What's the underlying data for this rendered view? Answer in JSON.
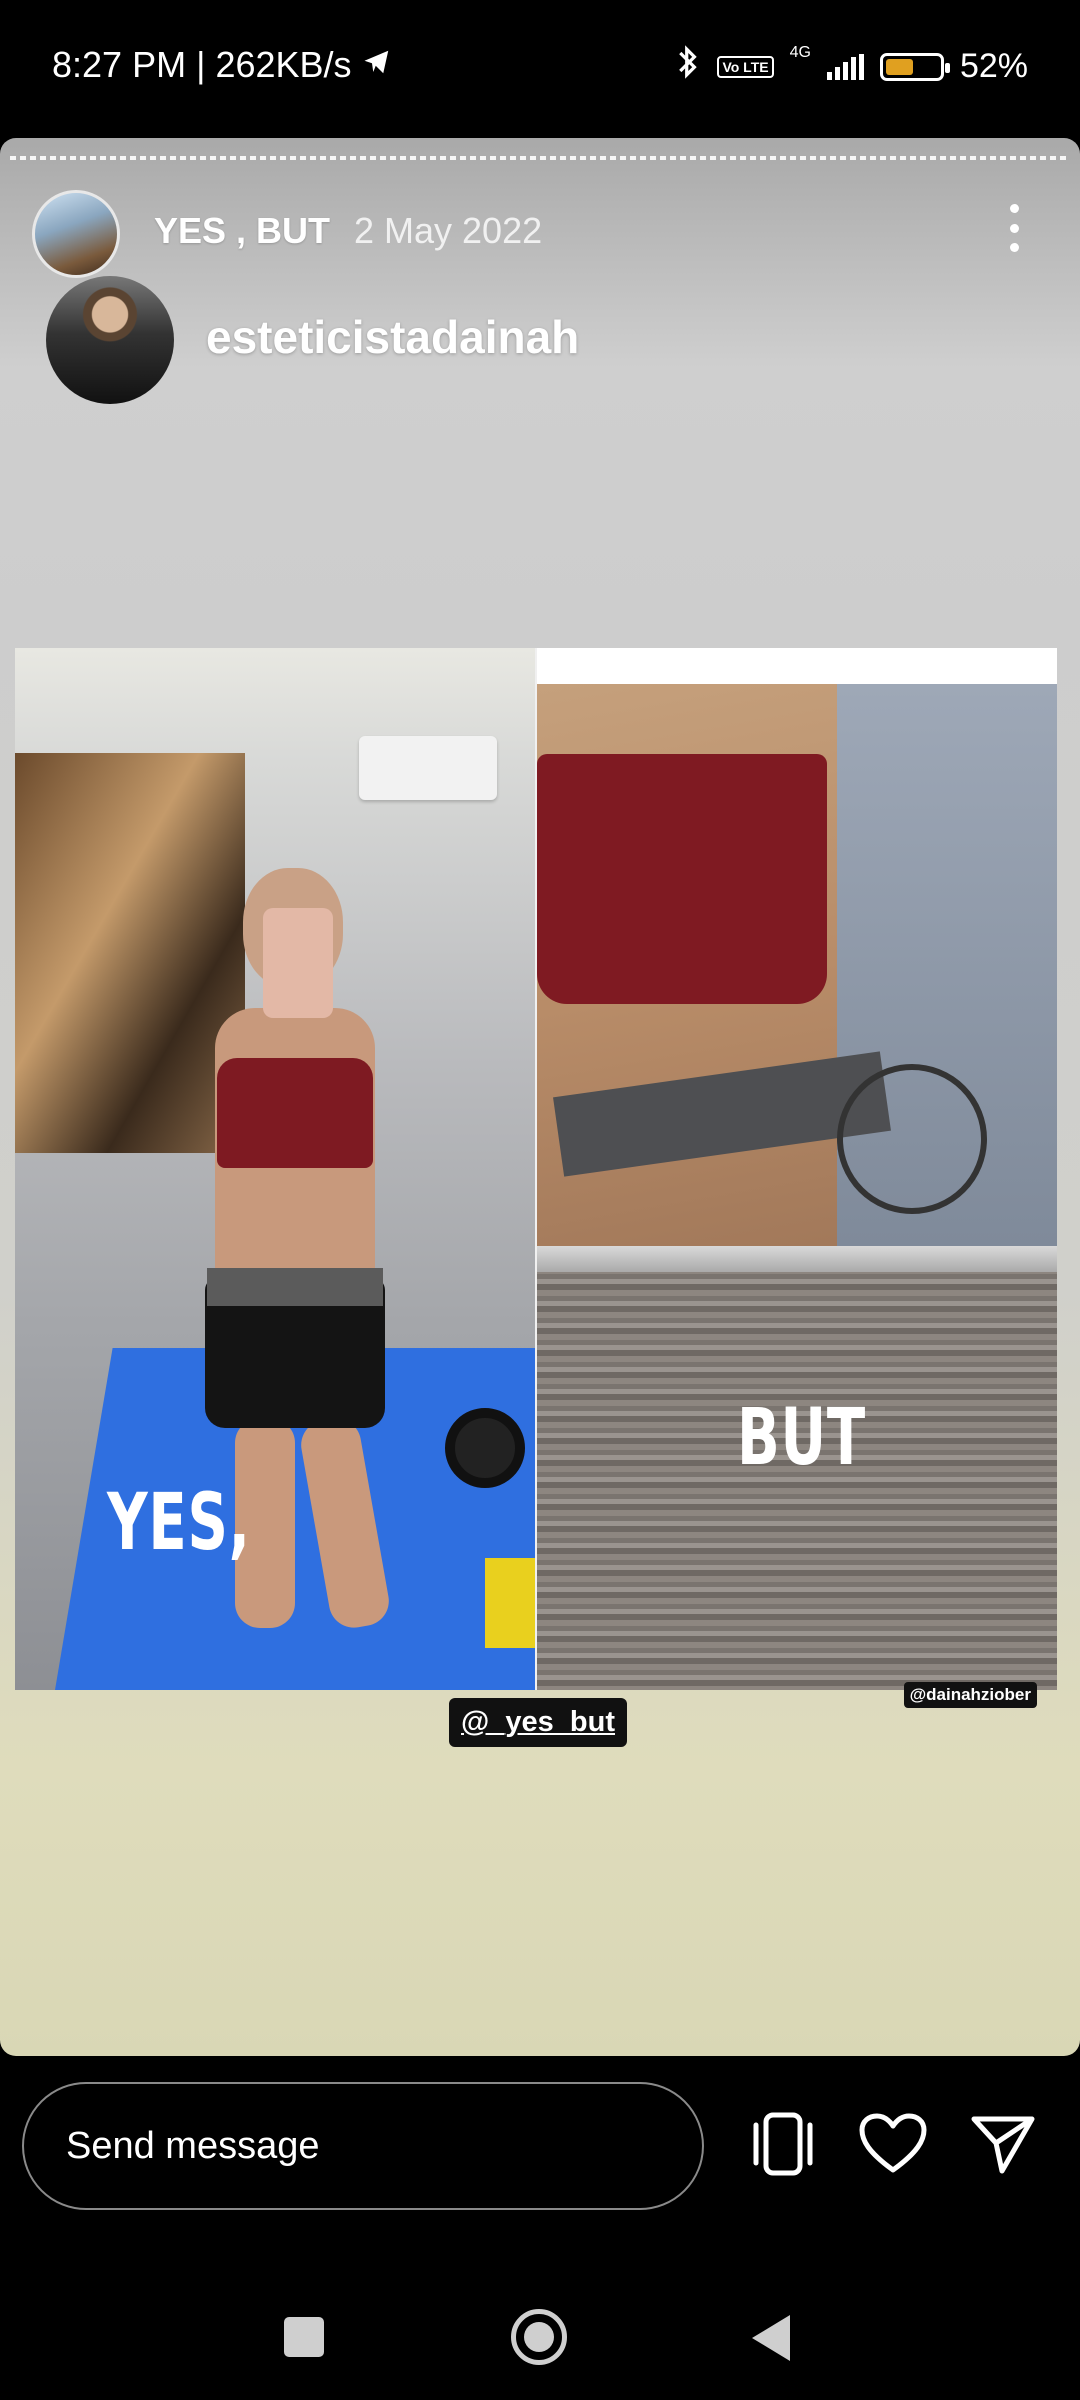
{
  "status_bar": {
    "time": "8:27 PM",
    "speed": "262KB/s",
    "network": "4G",
    "volte": "Vo LTE",
    "battery_percent": "52%",
    "battery_level": 0.52
  },
  "story": {
    "title": "YES , BUT",
    "date": "2 May 2022",
    "username": "esteticistadainah",
    "post": {
      "caption_left": "YES,",
      "caption_right": "BUT",
      "watermark": "@dainahziober"
    },
    "mention_sticker": "@_yes_but"
  },
  "message_bar": {
    "placeholder": "Send message"
  },
  "colors": {
    "battery_fill": "#e0a020",
    "background": "#000000"
  }
}
